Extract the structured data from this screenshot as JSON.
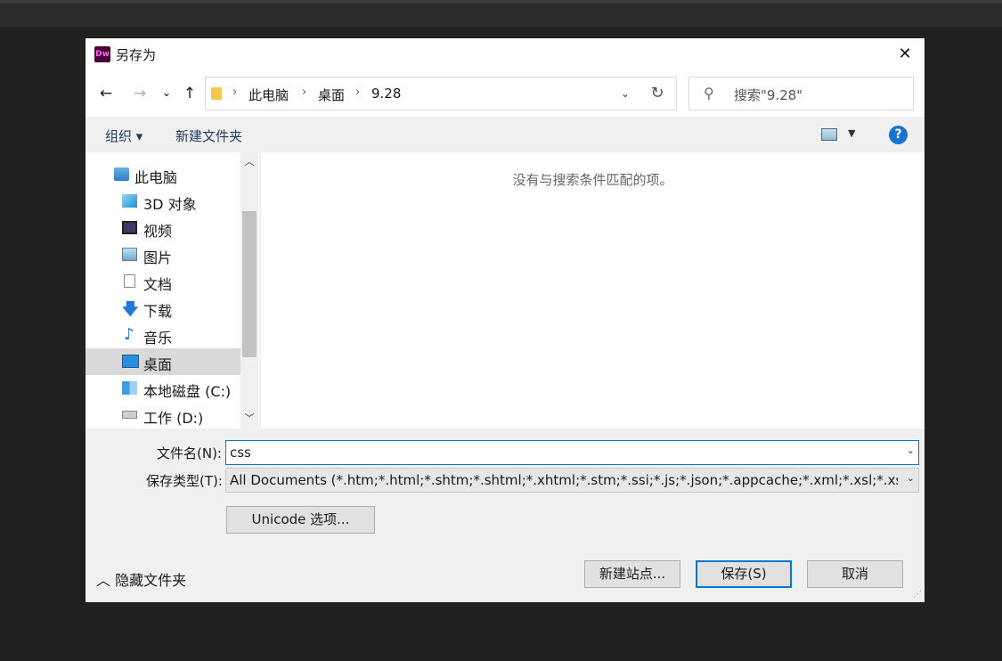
{
  "dialog": {
    "title": "另存为",
    "app_icon_text": "Dw",
    "close_glyph": "✕"
  },
  "nav": {
    "back": "←",
    "forward": "→",
    "recent": "⌄",
    "up": "↑",
    "breadcrumb": [
      "此电脑",
      "桌面",
      "9.28"
    ],
    "search_placeholder": "搜索\"9.28\""
  },
  "toolbar": {
    "organize": "组织 ▾",
    "new_folder": "新建文件夹",
    "help": "?"
  },
  "sidebar": {
    "items": [
      {
        "label": "此电脑",
        "icon": "computer-icon"
      },
      {
        "label": "3D 对象",
        "icon": "cube-icon"
      },
      {
        "label": "视频",
        "icon": "film-icon"
      },
      {
        "label": "图片",
        "icon": "picture-icon"
      },
      {
        "label": "文档",
        "icon": "document-icon"
      },
      {
        "label": "下载",
        "icon": "download-icon"
      },
      {
        "label": "音乐",
        "icon": "music-icon"
      },
      {
        "label": "桌面",
        "icon": "desktop-icon",
        "selected": true
      },
      {
        "label": "本地磁盘 (C:)",
        "icon": "windows-drive-icon"
      },
      {
        "label": "工作 (D:)",
        "icon": "drive-icon"
      }
    ]
  },
  "main": {
    "empty_message": "没有与搜索条件匹配的项。"
  },
  "form": {
    "filename_label": "文件名(N):",
    "filename_value": "css",
    "filetype_label": "保存类型(T):",
    "filetype_value": "All Documents (*.htm;*.html;*.shtm;*.shtml;*.xhtml;*.stm;*.ssi;*.js;*.json;*.appcache;*.xml;*.xsl;*.xsd;*.dtd",
    "unicode_button": "Unicode 选项..."
  },
  "footer": {
    "hide_folders": "隐藏文件夹",
    "new_site": "新建站点...",
    "save": "保存(S)",
    "cancel": "取消"
  }
}
